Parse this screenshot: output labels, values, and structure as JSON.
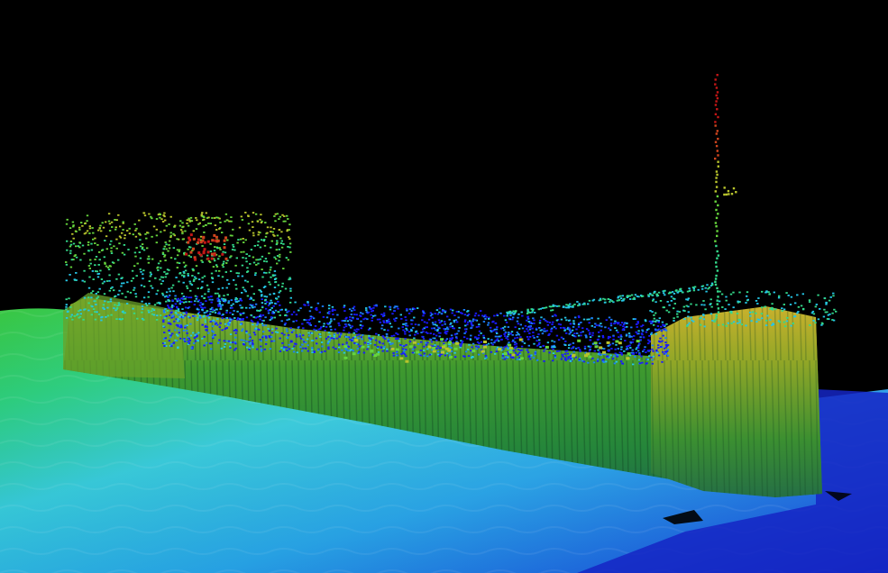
{
  "scene": {
    "kind": "multibeam-sonar-point-cloud",
    "subject": "shipwreck",
    "background": "#000000",
    "depth_colormap": [
      "#1a1aff",
      "#1b7dff",
      "#25c6e6",
      "#33d98a",
      "#66d53d",
      "#b8c42c",
      "#c99a2a",
      "#d0451e",
      "#c21616"
    ],
    "seafloor_colors": [
      "#0f1bb8",
      "#1f7fe6",
      "#3ad0e0",
      "#22d47a",
      "#23c02d"
    ],
    "hull_colors": [
      "#2e8a2f",
      "#6f9c24",
      "#b8a82a"
    ]
  }
}
